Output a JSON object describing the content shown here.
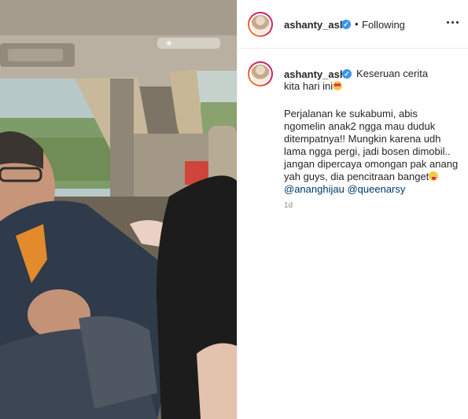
{
  "post": {
    "username": "ashanty_ash",
    "verified_mark": "✓",
    "separator": "•",
    "follow_status": "Following",
    "caption": {
      "username": "ashanty_ash",
      "first_line": "Keseruan cerita kita hari ini",
      "first_line_emoji": "heart-eyes-emoji",
      "body_lines": [
        "Perjalanan ke sukabumi, abis",
        "ngomelin anak2 ngga mau duduk",
        "ditempatnya!! Mungkin karena udh",
        "lama ngga pergi, jadi bosen dimobil..",
        "jangan dipercaya omongan pak anang",
        "yah guys, dia pencitraan banget"
      ],
      "last_line_emoji": "tongue-out-emoji",
      "mentions": [
        "@ananghijau",
        "@queenarsy"
      ],
      "timestamp": "1d"
    }
  },
  "colors": {
    "mention": "#00376b",
    "verified": "#3897f0",
    "muted": "#8e8e8e"
  }
}
